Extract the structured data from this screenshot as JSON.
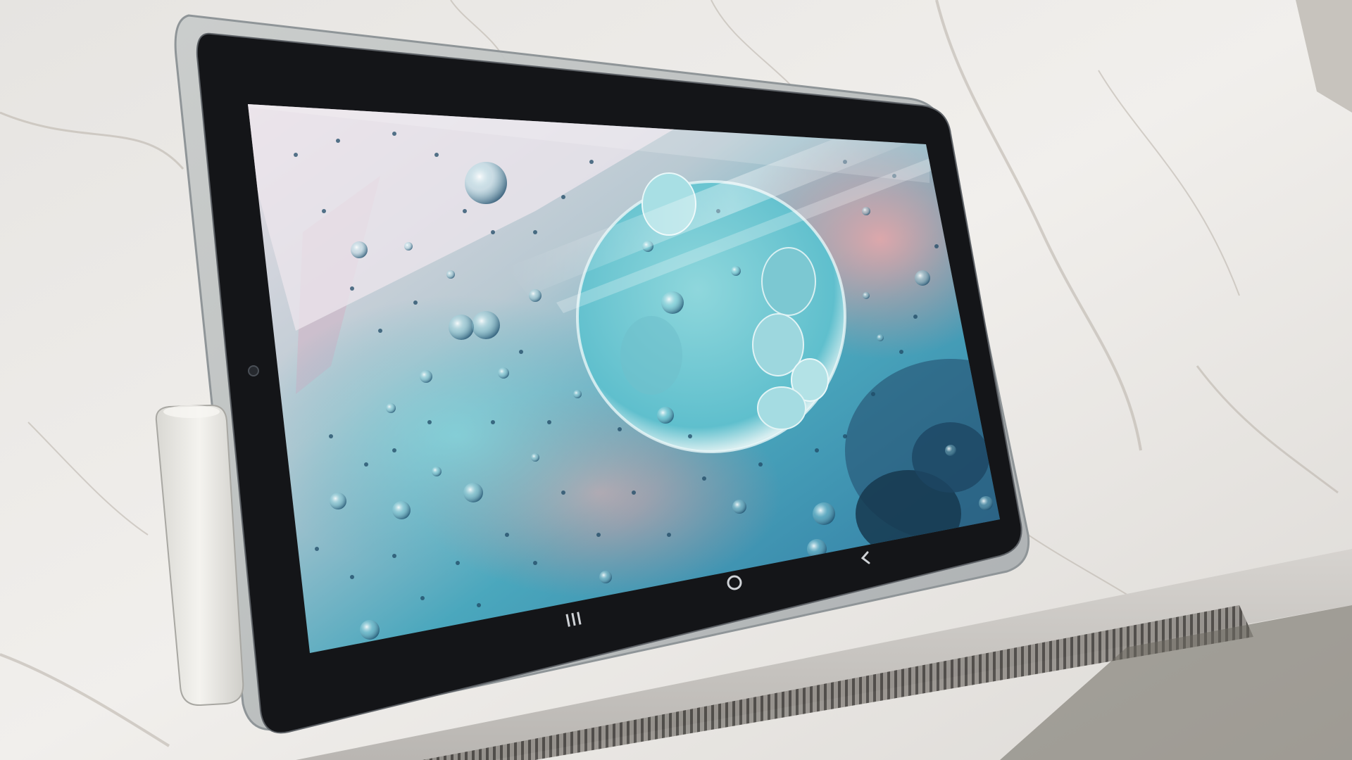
{
  "photo": {
    "subject": "tablet-on-marble-windowsill",
    "wallpaper": "oil-droplets-on-water",
    "navigation_bar": {
      "buttons": [
        {
          "name": "recents-icon",
          "glyph": "|||"
        },
        {
          "name": "home-icon",
          "glyph": "○"
        },
        {
          "name": "back-icon",
          "glyph": "‹"
        }
      ]
    },
    "colors": {
      "marble": "#e8e5e1",
      "case": "#bfc3c3",
      "bezel": "#141518",
      "screen_teal": "#5fc6d0",
      "screen_blue": "#3a8fb8",
      "screen_pink": "#d9a7b0",
      "stylus": "#ecebe6"
    }
  }
}
